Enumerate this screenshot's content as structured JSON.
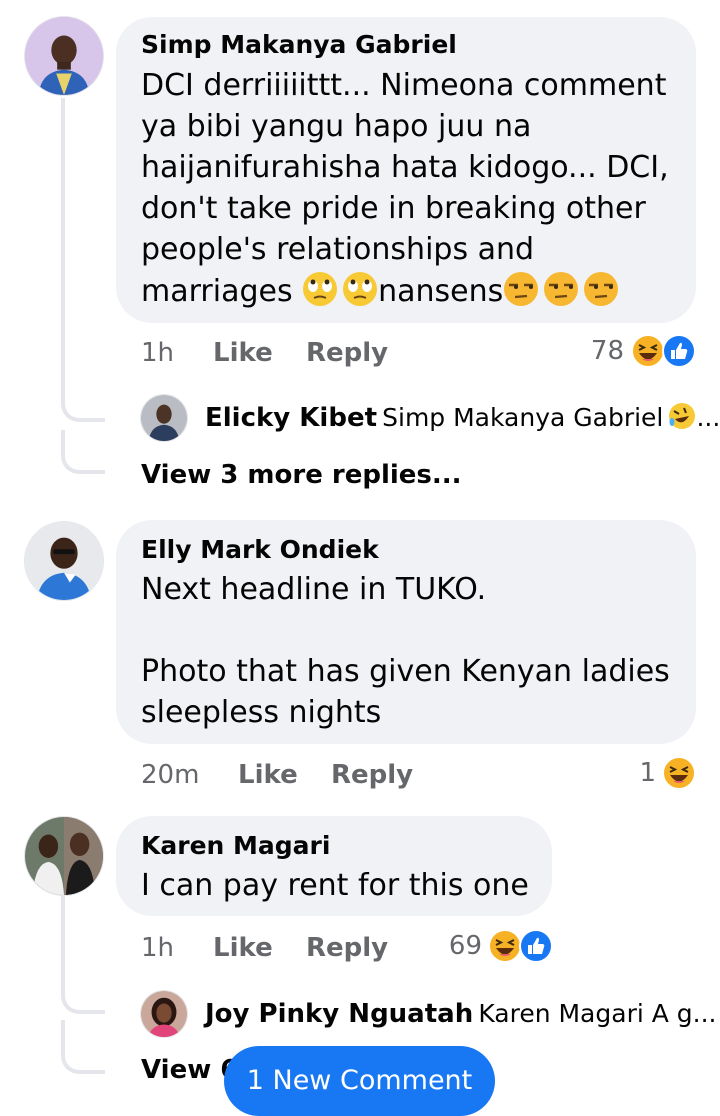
{
  "comments": [
    {
      "author": "Simp Makanya Gabriel",
      "lines": [
        "DCI derriiiiittt... Nimeona comment",
        "ya bibi yangu hapo juu na",
        "haijanifurahisha hata kidogo... DCI,",
        "don't take pride in breaking other",
        "people's relationships and"
      ],
      "last_line": {
        "a": "marriages ",
        "b": "nansens"
      },
      "last_line_emoji": [
        "rolling-eyes-emoji",
        "rolling-eyes-emoji",
        "unamused-emoji",
        "unamused-emoji",
        "unamused-emoji"
      ],
      "time": "1h",
      "like": "Like",
      "reply": "Reply",
      "reaction_count": "78",
      "reactions": [
        "haha-reaction-icon",
        "like-reaction-icon"
      ],
      "replies": [
        {
          "author": "Elicky Kibet",
          "text": "Simp Makanya Gabriel",
          "trailing": "rofl-emoji",
          "ellipsis": "..."
        }
      ],
      "view_more": "View 3 more replies..."
    },
    {
      "author": "Elly Mark Ondiek",
      "lines": [
        "Next headline in TUKO.",
        "",
        "Photo that has given Kenyan ladies",
        "sleepless nights"
      ],
      "time": "20m",
      "like": "Like",
      "reply": "Reply",
      "reaction_count": "1",
      "reactions": [
        "haha-reaction-icon"
      ]
    },
    {
      "author": "Karen Magari",
      "lines": [
        "I can pay rent for this one"
      ],
      "time": "1h",
      "like": "Like",
      "reply": "Reply",
      "reaction_count": "69",
      "reactions": [
        "haha-reaction-icon",
        "like-reaction-icon"
      ],
      "replies": [
        {
          "author": "Joy Pinky Nguatah",
          "text": "Karen Magari A g..."
        }
      ],
      "view_more_partial": "View 6"
    }
  ],
  "new_comment_pill": "1 New Comment",
  "colors": {
    "bubble": "#f0f2f5",
    "meta_text": "#65676b",
    "like_blue": "#1877f2",
    "haha_yellow": "#f7b125",
    "pill": "#1877f2",
    "thread_line": "#e4e6eb"
  }
}
